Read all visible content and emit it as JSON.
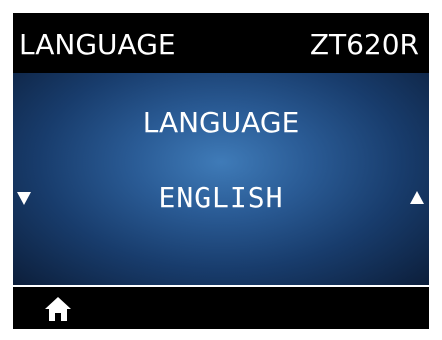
{
  "header": {
    "title": "LANGUAGE",
    "model": "ZT620R"
  },
  "panel": {
    "title": "LANGUAGE",
    "value": "ENGLISH",
    "prev_icon": "triangle-down-icon",
    "next_icon": "triangle-up-icon"
  },
  "footer": {
    "home_icon": "home-icon"
  },
  "colors": {
    "text": "#ffffff",
    "background": "#000000",
    "panel_center": "#3f7bb8",
    "panel_edge": "#0c1e3a"
  }
}
